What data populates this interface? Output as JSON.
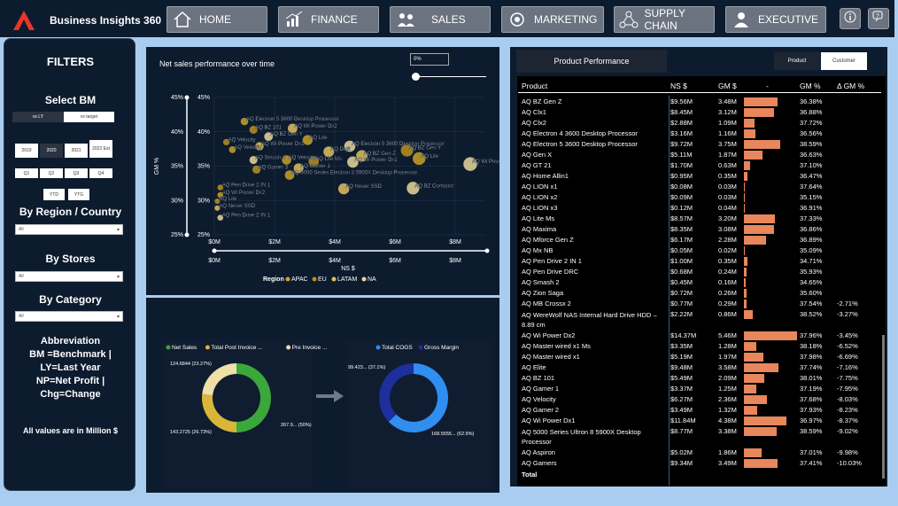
{
  "app": {
    "title": "Business Insights 360"
  },
  "nav": {
    "items": [
      {
        "label": "HOME",
        "icon": "home-icon"
      },
      {
        "label": "FINANCE",
        "icon": "finance-chart-icon"
      },
      {
        "label": "SALES",
        "icon": "sales-people-icon"
      },
      {
        "label": "MARKETING",
        "icon": "marketing-icon"
      },
      {
        "label": "SUPPLY CHAIN",
        "icon": "supply-chain-icon"
      },
      {
        "label": "EXECUTIVE",
        "icon": "executive-icon"
      }
    ]
  },
  "filters": {
    "title": "FILTERS",
    "select_bm": "Select BM",
    "bm_options": [
      "vs LY",
      "vs target"
    ],
    "years": [
      "2019",
      "2020",
      "2021",
      "2022 Est"
    ],
    "quarters": [
      "Q1",
      "Q2",
      "Q3",
      "Q4"
    ],
    "ytd": [
      "YTD",
      "YTG"
    ],
    "region_title": "By Region / Country",
    "region_value": "All",
    "stores_title": "By Stores",
    "stores_value": "All",
    "category_title": "By Category",
    "category_value": "All",
    "abbrev": [
      "Abbreviation",
      "BM =Benchmark |",
      "LY=Last Year",
      "NP=Net Profit |",
      "Chg=Change"
    ],
    "note": "All values are in Million $"
  },
  "scatter": {
    "title": "Net sales performance over time",
    "slider_value": "0%",
    "xlabel": "NS $",
    "ylabel": "GM %",
    "legend_title": "Region",
    "legend": [
      {
        "name": "APAC",
        "color": "#c9a227"
      },
      {
        "name": "EU",
        "color": "#b8901e"
      },
      {
        "name": "LATAM",
        "color": "#e0c060"
      },
      {
        "name": "NA",
        "color": "#e8d79a"
      }
    ],
    "range_min": "$0M",
    "range_max": "$8M"
  },
  "chart_data": [
    {
      "type": "scatter",
      "title": "Net sales performance over time",
      "xlabel": "NS $",
      "ylabel": "GM %",
      "xlim": [
        0,
        9
      ],
      "ylim": [
        25,
        45
      ],
      "xticks": [
        "$0M",
        "$2M",
        "$4M",
        "$6M",
        "$8M"
      ],
      "yticks": [
        "25%",
        "30%",
        "35%",
        "40%",
        "45%"
      ],
      "points": [
        {
          "label": "AQ Electron 5 3600 Desktop Processor",
          "x": 1.0,
          "y": 41.5
        },
        {
          "label": "AQ BZ 101",
          "x": 1.3,
          "y": 40.3
        },
        {
          "label": "AQ Wi Power Dx2",
          "x": 2.6,
          "y": 40.5
        },
        {
          "label": "AQ BZ Gen Y",
          "x": 1.8,
          "y": 39.3
        },
        {
          "label": "AQ Lite",
          "x": 3.1,
          "y": 38.8
        },
        {
          "label": "AQ Velocity",
          "x": 0.4,
          "y": 38.5
        },
        {
          "label": "AQ Wi Power Dx1",
          "x": 1.5,
          "y": 37.9
        },
        {
          "label": "AQ Electron 5 3600 Desktop Processor",
          "x": 4.5,
          "y": 37.9
        },
        {
          "label": "AQ Velocity",
          "x": 0.6,
          "y": 37.4
        },
        {
          "label": "AQ BZ Gen Y",
          "x": 6.4,
          "y": 37.3
        },
        {
          "label": "AQ Digit",
          "x": 3.8,
          "y": 37.1
        },
        {
          "label": "AQ Smash 1",
          "x": 1.3,
          "y": 35.9
        },
        {
          "label": "AQ Velocity",
          "x": 2.4,
          "y": 35.9
        },
        {
          "label": "AQ Lite Ms",
          "x": 3.3,
          "y": 35.7
        },
        {
          "label": "AQ BZ Gen Z",
          "x": 4.9,
          "y": 36.5
        },
        {
          "label": "AQ Wi Power Dx1",
          "x": 4.6,
          "y": 35.6
        },
        {
          "label": "AQ Lite",
          "x": 6.8,
          "y": 36.1
        },
        {
          "label": "AQ Gamer 3",
          "x": 1.4,
          "y": 34.5
        },
        {
          "label": "AQ Gamer 1",
          "x": 2.8,
          "y": 34.7
        },
        {
          "label": "AQ Wi Power Dx2",
          "x": 8.5,
          "y": 35.3
        },
        {
          "label": "AQ 5000 Series Electron 8 5900X Desktop Processor",
          "x": 2.5,
          "y": 33.7
        },
        {
          "label": "AQ Pen Drive 2 IN 1",
          "x": 0.2,
          "y": 31.9
        },
        {
          "label": "AQ Neuer SSD",
          "x": 4.3,
          "y": 31.7
        },
        {
          "label": "AQ BZ Compact",
          "x": 6.6,
          "y": 31.8
        },
        {
          "label": "AQ Wi Power Dx2",
          "x": 0.2,
          "y": 30.8
        },
        {
          "label": "AQ Lite",
          "x": 0.1,
          "y": 29.9
        },
        {
          "label": "AQ Neuer SSD",
          "x": 0.1,
          "y": 28.9
        },
        {
          "label": "AQ Pen Drive 2 IN 1",
          "x": 0.2,
          "y": 27.5
        }
      ]
    },
    {
      "type": "pie",
      "legend": [
        "Net Sales",
        "Total Post Invoice ...",
        "Pre Invoice ..."
      ],
      "colors": [
        "#3aa83a",
        "#d9b53a",
        "#efe0a8"
      ],
      "values": [
        267.9,
        143.2725,
        124.6844
      ],
      "labels": [
        "267.9... (50%)",
        "143.2725 (26.73%)",
        "124.6844 (23.27%)"
      ]
    },
    {
      "type": "pie",
      "legend": [
        "Total COGS",
        "Gross Margin"
      ],
      "colors": [
        "#2f8ef0",
        "#1c2f9c"
      ],
      "values": [
        168.5555,
        99.423
      ],
      "labels": [
        "168.5555... (62.9%)",
        "99.423... (37.1%)"
      ]
    }
  ],
  "product_performance": {
    "title": "Product Performance",
    "toggle": [
      "Product",
      "Customer"
    ],
    "columns": [
      "Product",
      "NS $",
      "GM $",
      "-",
      "GM %",
      "Δ GM %"
    ],
    "rows": [
      {
        "name": "AQ BZ Gen Z",
        "ns": "$9.56M",
        "gm": "3.48M",
        "gmv": 3.48,
        "gmp": "36.38%",
        "d": ""
      },
      {
        "name": "AQ Clx1",
        "ns": "$8.45M",
        "gm": "3.12M",
        "gmv": 3.12,
        "gmp": "36.88%",
        "d": ""
      },
      {
        "name": "AQ Clx2",
        "ns": "$2.88M",
        "gm": "1.09M",
        "gmv": 1.09,
        "gmp": "37.72%",
        "d": ""
      },
      {
        "name": "AQ Electron 4 3600 Desktop Processor",
        "ns": "$3.16M",
        "gm": "1.16M",
        "gmv": 1.16,
        "gmp": "36.56%",
        "d": ""
      },
      {
        "name": "AQ Electron 5 3600 Desktop Processor",
        "ns": "$9.72M",
        "gm": "3.75M",
        "gmv": 3.75,
        "gmp": "38.59%",
        "d": ""
      },
      {
        "name": "AQ Gen X",
        "ns": "$5.11M",
        "gm": "1.87M",
        "gmv": 1.87,
        "gmp": "36.63%",
        "d": ""
      },
      {
        "name": "AQ GT 21",
        "ns": "$1.70M",
        "gm": "0.63M",
        "gmv": 0.63,
        "gmp": "37.10%",
        "d": ""
      },
      {
        "name": "AQ Home Allin1",
        "ns": "$0.95M",
        "gm": "0.35M",
        "gmv": 0.35,
        "gmp": "36.47%",
        "d": ""
      },
      {
        "name": "AQ LION x1",
        "ns": "$0.08M",
        "gm": "0.03M",
        "gmv": 0.03,
        "gmp": "37.64%",
        "d": ""
      },
      {
        "name": "AQ LION x2",
        "ns": "$0.09M",
        "gm": "0.03M",
        "gmv": 0.03,
        "gmp": "35.15%",
        "d": ""
      },
      {
        "name": "AQ LION x3",
        "ns": "$0.12M",
        "gm": "0.04M",
        "gmv": 0.04,
        "gmp": "36.91%",
        "d": ""
      },
      {
        "name": "AQ Lite Ms",
        "ns": "$8.57M",
        "gm": "3.20M",
        "gmv": 3.2,
        "gmp": "37.33%",
        "d": ""
      },
      {
        "name": "AQ Maxima",
        "ns": "$8.35M",
        "gm": "3.08M",
        "gmv": 3.08,
        "gmp": "36.86%",
        "d": ""
      },
      {
        "name": "AQ Mforce Gen Z",
        "ns": "$6.17M",
        "gm": "2.28M",
        "gmv": 2.28,
        "gmp": "36.89%",
        "d": ""
      },
      {
        "name": "AQ Mx NB",
        "ns": "$0.05M",
        "gm": "0.02M",
        "gmv": 0.02,
        "gmp": "35.09%",
        "d": ""
      },
      {
        "name": "AQ Pen Drive 2 IN 1",
        "ns": "$1.00M",
        "gm": "0.35M",
        "gmv": 0.35,
        "gmp": "34.71%",
        "d": ""
      },
      {
        "name": "AQ Pen Drive DRC",
        "ns": "$0.68M",
        "gm": "0.24M",
        "gmv": 0.24,
        "gmp": "35.93%",
        "d": ""
      },
      {
        "name": "AQ Smash 2",
        "ns": "$0.45M",
        "gm": "0.16M",
        "gmv": 0.16,
        "gmp": "34.65%",
        "d": ""
      },
      {
        "name": "AQ Zion Saga",
        "ns": "$0.72M",
        "gm": "0.26M",
        "gmv": 0.26,
        "gmp": "35.60%",
        "d": ""
      },
      {
        "name": "AQ MB Crossx 2",
        "ns": "$0.77M",
        "gm": "0.29M",
        "gmv": 0.29,
        "gmp": "37.54%",
        "d": "-2.71%"
      },
      {
        "name": "AQ WereWolf NAS Internal Hard Drive HDD – 8.89 cm",
        "ns": "$2.22M",
        "gm": "0.86M",
        "gmv": 0.86,
        "gmp": "38.52%",
        "d": "-3.27%"
      },
      {
        "name": "AQ Wi Power Dx2",
        "ns": "$14.37M",
        "gm": "5.46M",
        "gmv": 5.46,
        "gmp": "37.96%",
        "d": "-3.45%"
      },
      {
        "name": "AQ Master wired x1 Ms",
        "ns": "$3.35M",
        "gm": "1.28M",
        "gmv": 1.28,
        "gmp": "38.18%",
        "d": "-6.52%"
      },
      {
        "name": "AQ Master wired x1",
        "ns": "$5.19M",
        "gm": "1.97M",
        "gmv": 1.97,
        "gmp": "37.98%",
        "d": "-6.69%"
      },
      {
        "name": "AQ Elite",
        "ns": "$9.48M",
        "gm": "3.58M",
        "gmv": 3.58,
        "gmp": "37.74%",
        "d": "-7.16%"
      },
      {
        "name": "AQ BZ 101",
        "ns": "$5.49M",
        "gm": "2.09M",
        "gmv": 2.09,
        "gmp": "38.01%",
        "d": "-7.75%"
      },
      {
        "name": "AQ Gamer 1",
        "ns": "$3.37M",
        "gm": "1.25M",
        "gmv": 1.25,
        "gmp": "37.19%",
        "d": "-7.95%"
      },
      {
        "name": "AQ Velocity",
        "ns": "$6.27M",
        "gm": "2.36M",
        "gmv": 2.36,
        "gmp": "37.68%",
        "d": "-8.03%"
      },
      {
        "name": "AQ Gamer 2",
        "ns": "$3.49M",
        "gm": "1.32M",
        "gmv": 1.32,
        "gmp": "37.93%",
        "d": "-8.23%"
      },
      {
        "name": "AQ Wi Power Dx1",
        "ns": "$11.84M",
        "gm": "4.38M",
        "gmv": 4.38,
        "gmp": "36.97%",
        "d": "-8.37%"
      },
      {
        "name": "AQ 5000 Series Ultron 8 5900X Desktop Processor",
        "ns": "$8.77M",
        "gm": "3.38M",
        "gmv": 3.38,
        "gmp": "38.59%",
        "d": "-9.02%"
      },
      {
        "name": "AQ Aspiron",
        "ns": "$5.02M",
        "gm": "1.86M",
        "gmv": 1.86,
        "gmp": "37.01%",
        "d": "-9.98%"
      },
      {
        "name": "AQ Gamers",
        "ns": "$9.34M",
        "gm": "3.49M",
        "gmv": 3.49,
        "gmp": "37.41%",
        "d": "-10.03%"
      }
    ],
    "total_label": "Total"
  }
}
